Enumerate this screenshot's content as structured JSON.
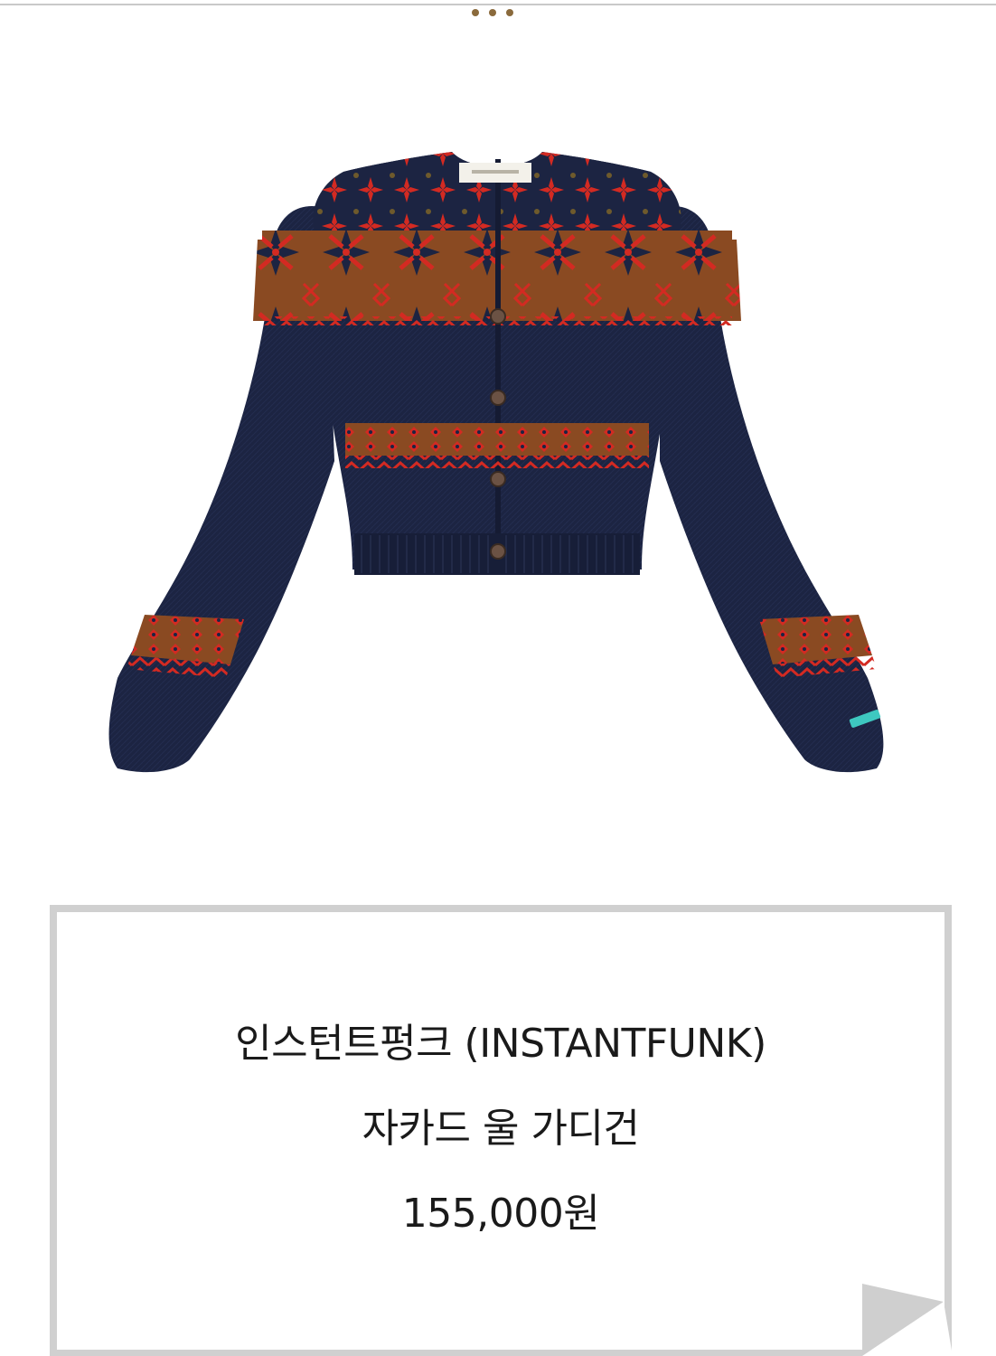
{
  "header": {
    "menu_icon": "more-dots-icon",
    "accent": "#8a6a3c"
  },
  "product": {
    "image_icon": "cardigan-product-image",
    "colors": {
      "body": "#1c2442",
      "red": "#d32a22",
      "brown": "#8a4a22",
      "olive": "#6e5a2c",
      "label": "#3ec8c0"
    },
    "brand": "인스턴트펑크 (INSTANTFUNK)",
    "name": "자카드 울 가디건",
    "price": "155,000원"
  }
}
